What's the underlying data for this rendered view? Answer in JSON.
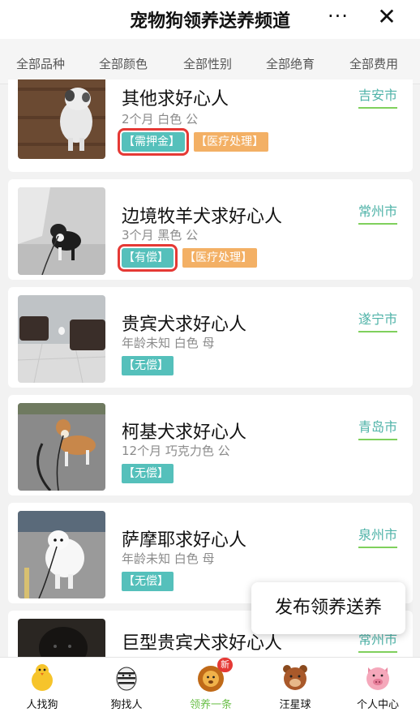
{
  "title": "宠物狗领养送养频道",
  "more_label": "···",
  "close_label": "✕",
  "filters": [
    "全部品种",
    "全部颜色",
    "全部性别",
    "全部绝育",
    "全部费用"
  ],
  "listings": [
    {
      "name": "其他求好心人",
      "city": "吉安市",
      "meta": "2个月 白色 公",
      "tags": [
        "【需押金】",
        "【医疗处理】"
      ]
    },
    {
      "name": "边境牧羊犬求好心人",
      "city": "常州市",
      "meta": "3个月 黑色 公",
      "tags": [
        "【有偿】",
        "【医疗处理】"
      ]
    },
    {
      "name": "贵宾犬求好心人",
      "city": "遂宁市",
      "meta": "年龄未知 白色 母",
      "tags": [
        "【无偿】"
      ]
    },
    {
      "name": "柯基犬求好心人",
      "city": "青岛市",
      "meta": "12个月 巧克力色 公",
      "tags": [
        "【无偿】"
      ]
    },
    {
      "name": "萨摩耶求好心人",
      "city": "泉州市",
      "meta": "年龄未知 白色 母",
      "tags": [
        "【无偿】"
      ]
    },
    {
      "name": "巨型贵宾犬求好心人",
      "city": "常州市",
      "meta": "",
      "tags": []
    }
  ],
  "publish_button": "发布领养送养",
  "tabs": [
    {
      "label": "人找狗",
      "icon": "chick-icon"
    },
    {
      "label": "狗找人",
      "icon": "zebra-icon"
    },
    {
      "label": "领养一条",
      "icon": "lion-icon",
      "badge": "新",
      "active": true
    },
    {
      "label": "汪星球",
      "icon": "bear-icon"
    },
    {
      "label": "个人中心",
      "icon": "pig-icon"
    }
  ],
  "colors": {
    "accent_green": "#6cc04a",
    "city_teal": "#4fb3a8",
    "tag_teal": "#55c0bb",
    "tag_orange": "#f3b065",
    "highlight_red": "#e53935"
  }
}
